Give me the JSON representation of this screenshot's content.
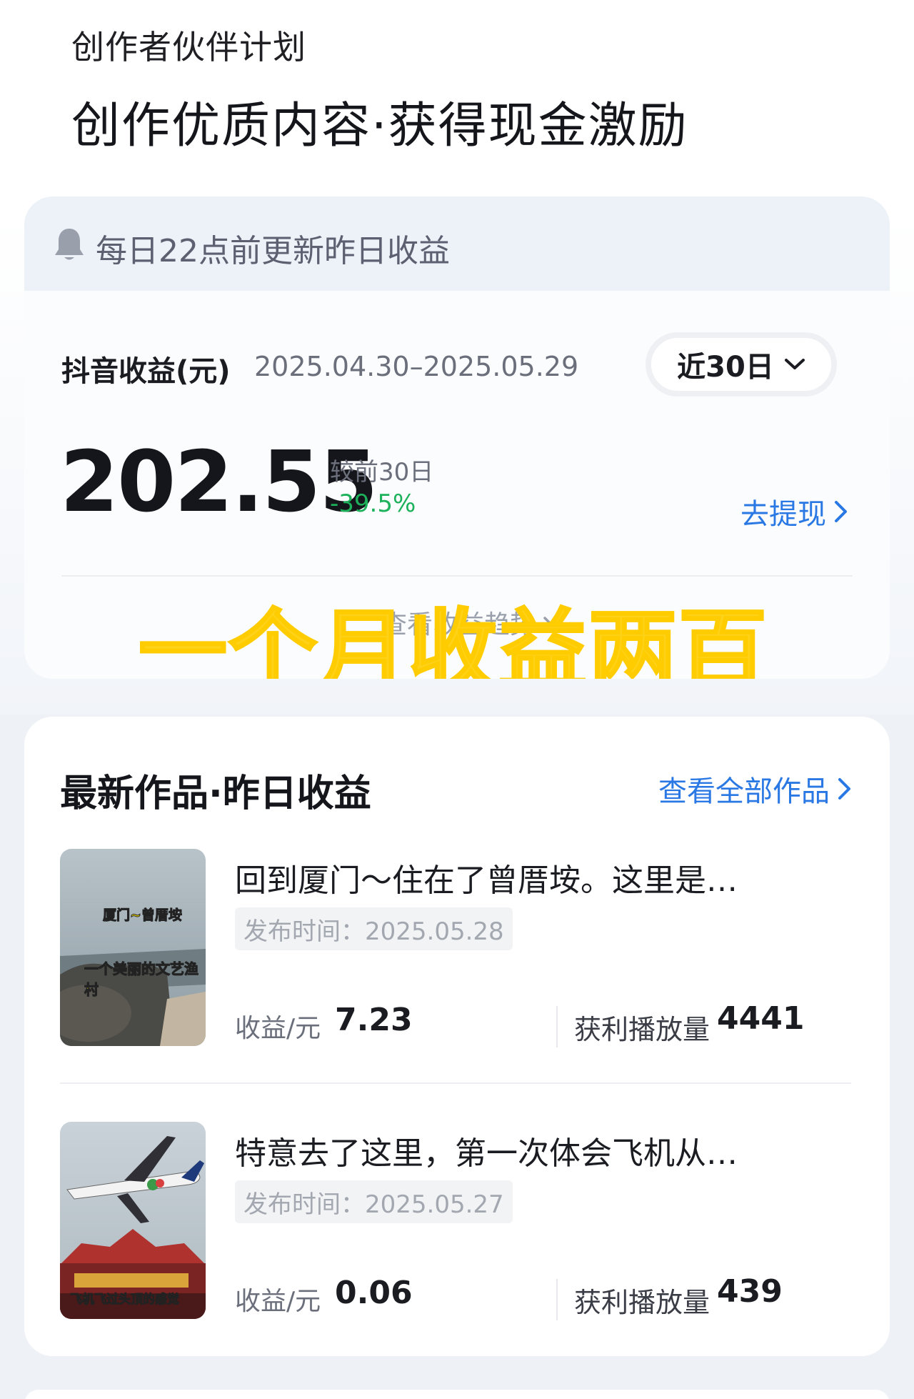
{
  "header": {
    "subtitle": "创作者伙伴计划",
    "title": "创作优质内容·获得现金激励"
  },
  "notice": {
    "icon": "bell-icon",
    "text": "每日22点前更新昨日收益"
  },
  "earnings": {
    "label": "抖音收益(元)",
    "range": "2025.04.30–2025.05.29",
    "period": "近30日",
    "amount": "202.55",
    "compare_label": "较前30日",
    "compare_delta": "-39.5%",
    "withdraw": "去提现",
    "detail_link": "查看收益趋势",
    "overlay": "一个月收益两百"
  },
  "works": {
    "title": "最新作品·昨日收益",
    "view_all": "查看全部作品",
    "items": [
      {
        "title": "回到厦门～住在了曾厝垵。这里是…",
        "publish": "发布时间：2025.05.28",
        "income_label": "收益/元",
        "income": "7.23",
        "plays_label": "获利播放量",
        "plays": "4441",
        "thumb_text_1": "厦门~曾厝垵",
        "thumb_text_2": "一个美丽的文艺渔村"
      },
      {
        "title": "特意去了这里，第一次体会飞机从…",
        "publish": "发布时间：2025.05.27",
        "income_label": "收益/元",
        "income": "0.06",
        "plays_label": "获利播放量",
        "plays": "439",
        "thumb_text_1": "飞机飞过头顶的感觉"
      }
    ]
  },
  "colors": {
    "accent": "#2a78e4",
    "positive": "#1cb15a",
    "overlay": "#ffd21a"
  }
}
